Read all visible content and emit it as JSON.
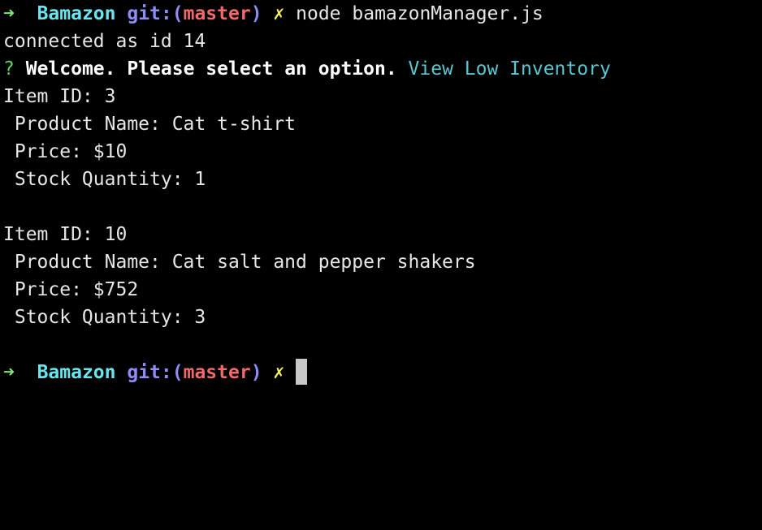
{
  "prompt": {
    "arrow": "➜",
    "dir": "Bamazon",
    "git_prefix": "git:(",
    "branch": "master",
    "git_suffix": ")",
    "dirty_mark": "✗"
  },
  "command": "node bamazonManager.js",
  "connected_line": "connected as id 14",
  "question": {
    "mark": "?",
    "text": "Welcome. Please select an option.",
    "answer": "View Low Inventory"
  },
  "items": [
    {
      "id_line": "Item ID: 3",
      "name_line": " Product Name: Cat t-shirt",
      "price_line": " Price: $10",
      "stock_line": " Stock Quantity: 1"
    },
    {
      "id_line": "Item ID: 10",
      "name_line": " Product Name: Cat salt and pepper shakers",
      "price_line": " Price: $752",
      "stock_line": " Stock Quantity: 3"
    }
  ],
  "colors": {
    "background": "#000000",
    "foreground": "#e6e6e6",
    "arrow": "#7fe67a",
    "dir": "#67e6f0",
    "git": "#8f8cf7",
    "branch": "#f06a6a",
    "dirty_mark": "#f3f15c",
    "question_mark": "#5dd35f",
    "answer": "#5bc6cf",
    "cursor": "#c8c8c8"
  }
}
